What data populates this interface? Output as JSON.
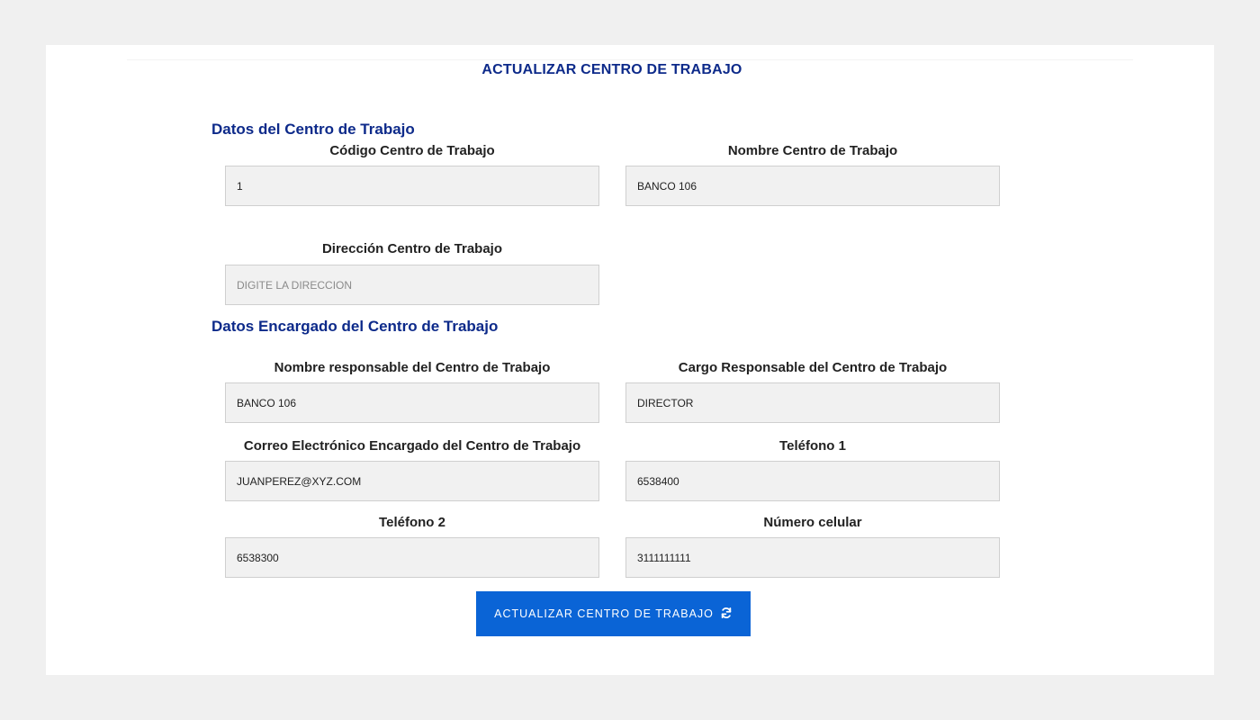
{
  "page": {
    "title": "ACTUALIZAR CENTRO DE TRABAJO"
  },
  "section_centro": {
    "title": "Datos del Centro de Trabajo",
    "codigo": {
      "label": "Código Centro de Trabajo",
      "value": "1"
    },
    "nombre": {
      "label": "Nombre Centro de Trabajo",
      "value": "BANCO 106"
    },
    "direccion": {
      "label": "Dirección Centro de Trabajo",
      "value": "",
      "placeholder": "DIGITE LA DIRECCION"
    }
  },
  "section_encargado": {
    "title": "Datos Encargado del Centro de Trabajo",
    "nombre_responsable": {
      "label": "Nombre responsable del Centro de Trabajo",
      "value": "BANCO 106"
    },
    "cargo_responsable": {
      "label": "Cargo Responsable del Centro de Trabajo",
      "value": "DIRECTOR"
    },
    "correo": {
      "label": "Correo Electrónico Encargado del Centro de Trabajo",
      "value": "JUANPEREZ@XYZ.COM"
    },
    "telefono1": {
      "label": "Teléfono 1",
      "value": "6538400"
    },
    "telefono2": {
      "label": "Teléfono 2",
      "value": "6538300"
    },
    "celular": {
      "label": "Número celular",
      "value": "3111111111"
    }
  },
  "submit": {
    "label": "ACTUALIZAR CENTRO DE TRABAJO",
    "icon": "refresh-icon"
  },
  "colors": {
    "page_background": "#f0f0f0",
    "card_background": "#ffffff",
    "heading_blue": "#0d2a8a",
    "button_blue": "#0a64d6",
    "input_background": "#f1f1f1",
    "input_border": "#cfcfcf"
  }
}
